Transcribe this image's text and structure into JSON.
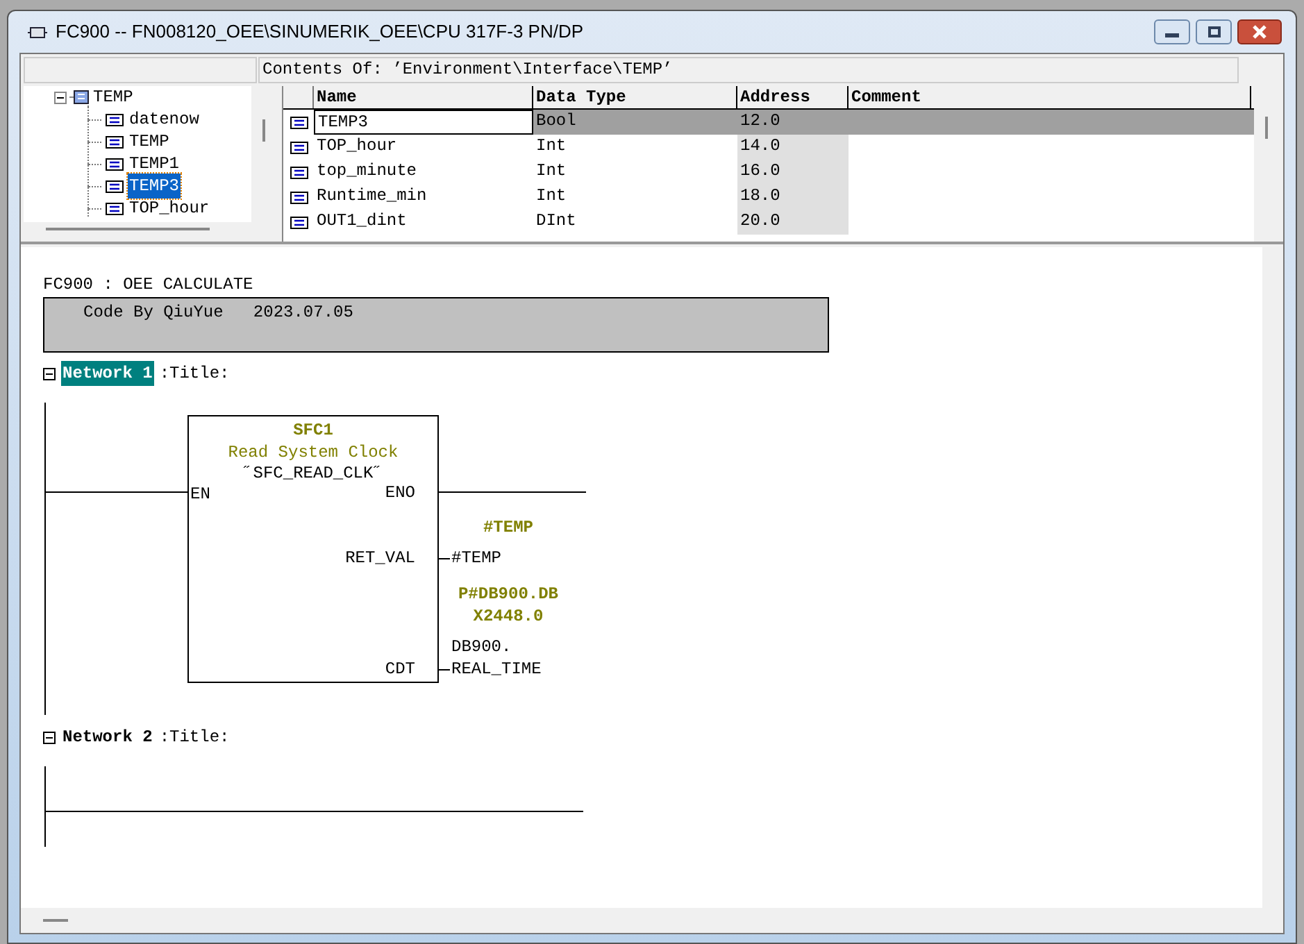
{
  "window": {
    "title": "FC900 -- FN008120_OEE\\SINUMERIK_OEE\\CPU 317F-3 PN/DP",
    "buttons": [
      {
        "kind": "minimize"
      },
      {
        "kind": "maximize"
      },
      {
        "kind": "close"
      }
    ]
  },
  "interface": {
    "contents_header": "Contents Of: ’Environment\\Interface\\TEMP’",
    "tree": {
      "label": "TEMP",
      "expanded": true,
      "selected": false,
      "children": [
        {
          "label": "datenow",
          "selected": false
        },
        {
          "label": "TEMP",
          "selected": false
        },
        {
          "label": "TEMP1",
          "selected": false
        },
        {
          "label": "TEMP3",
          "selected": true
        },
        {
          "label": "TOP_hour",
          "selected": false
        }
      ]
    },
    "table": {
      "columns": [
        "Name",
        "Data Type",
        "Address",
        "Comment"
      ],
      "rows": [
        {
          "name": "TEMP3",
          "data_type": "Bool",
          "address": "12.0",
          "selected": true
        },
        {
          "name": "TOP_hour",
          "data_type": "Int",
          "address": "14.0",
          "selected": false
        },
        {
          "name": "top_minute",
          "data_type": "Int",
          "address": "16.0",
          "selected": false
        },
        {
          "name": "Runtime_min",
          "data_type": "Int",
          "address": "18.0",
          "selected": false
        },
        {
          "name": "OUT1_dint",
          "data_type": "DInt",
          "address": "20.0",
          "selected": false
        }
      ]
    }
  },
  "editor": {
    "block_title": "FC900 : OEE CALCULATE",
    "block_comment": "Code By QiuYue   2023.07.05",
    "networks": [
      {
        "label": "Network 1",
        "title": ":Title:",
        "expanded": true,
        "selected": true,
        "box": {
          "name": "SFC1",
          "description": "Read System Clock",
          "symbol": "˝SFC_READ_CLK˝",
          "inputs": [
            "EN"
          ],
          "outputs": [
            "ENO",
            "RET_VAL",
            "CDT"
          ],
          "operands": [
            {
              "address_lines": [
                "#TEMP"
              ],
              "symbol_lines": [
                "#TEMP"
              ]
            },
            {
              "address_lines": [
                "P#DB900.DB",
                "X2448.0"
              ],
              "symbol_lines": [
                "DB900.",
                "REAL_TIME"
              ]
            }
          ]
        }
      },
      {
        "label": "Network 2",
        "title": ":Title:",
        "expanded": true,
        "selected": false
      }
    ]
  }
}
